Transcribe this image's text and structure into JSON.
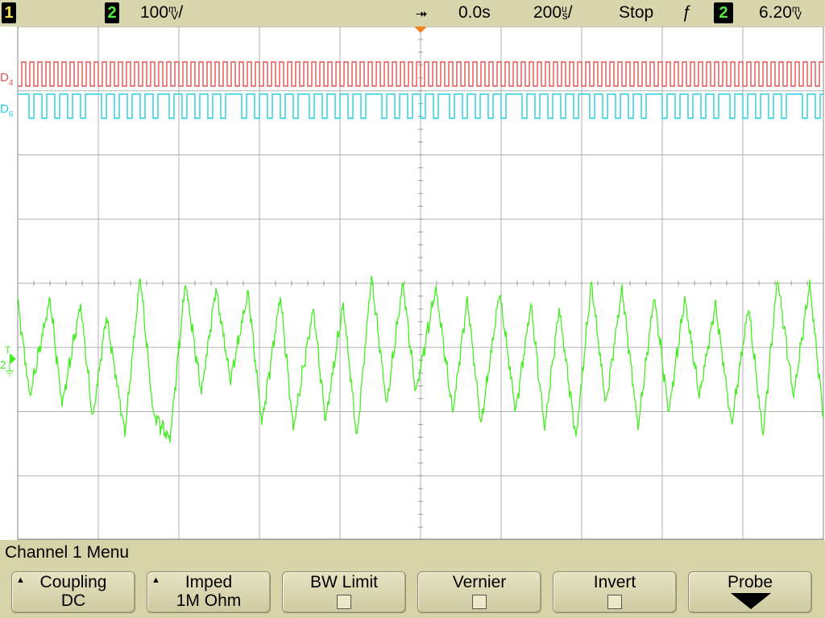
{
  "status": {
    "channel1_number": "1",
    "channel2_number": "2",
    "volts_per_div": "100",
    "volts_unit": "V",
    "volts_unit_prefix": "m",
    "volts_suffix": "/",
    "time_offset": "0.0s",
    "time_per_div": "200",
    "time_unit_prefix": "u",
    "time_unit": "s",
    "time_suffix": "/",
    "run_state": "Stop",
    "trigger_slope_glyph": "ƒ",
    "trigger_source": "2",
    "trigger_level": "6.20",
    "trigger_level_unit_prefix": "m",
    "trigger_level_unit": "V"
  },
  "markers": {
    "trigger_position_glyph": "⯆",
    "digital_labels": [
      {
        "name": "D",
        "sub": "4",
        "color": "#e85050"
      },
      {
        "name": "D",
        "sub": "6",
        "color": "#22d0e8"
      }
    ],
    "analog_ground_label": "2",
    "analog_trigger_label": "T"
  },
  "colors": {
    "d4": "#e85050",
    "d6": "#22d0e8",
    "analog": "#44ee22",
    "grid": "#b0b0b0",
    "background": "#ffffff",
    "panel": "#d6d3a9"
  },
  "menu": {
    "title": "Channel 1  Menu",
    "softkeys": [
      {
        "label": "Coupling",
        "value": "DC",
        "has_arrow": true
      },
      {
        "label": "Imped",
        "value": "1M Ohm",
        "has_arrow": true
      },
      {
        "label": "BW Limit",
        "checkbox": true
      },
      {
        "label": "Vernier",
        "checkbox": true
      },
      {
        "label": "Invert",
        "checkbox": true
      },
      {
        "label": "Probe",
        "submenu_arrow": true
      }
    ]
  }
}
